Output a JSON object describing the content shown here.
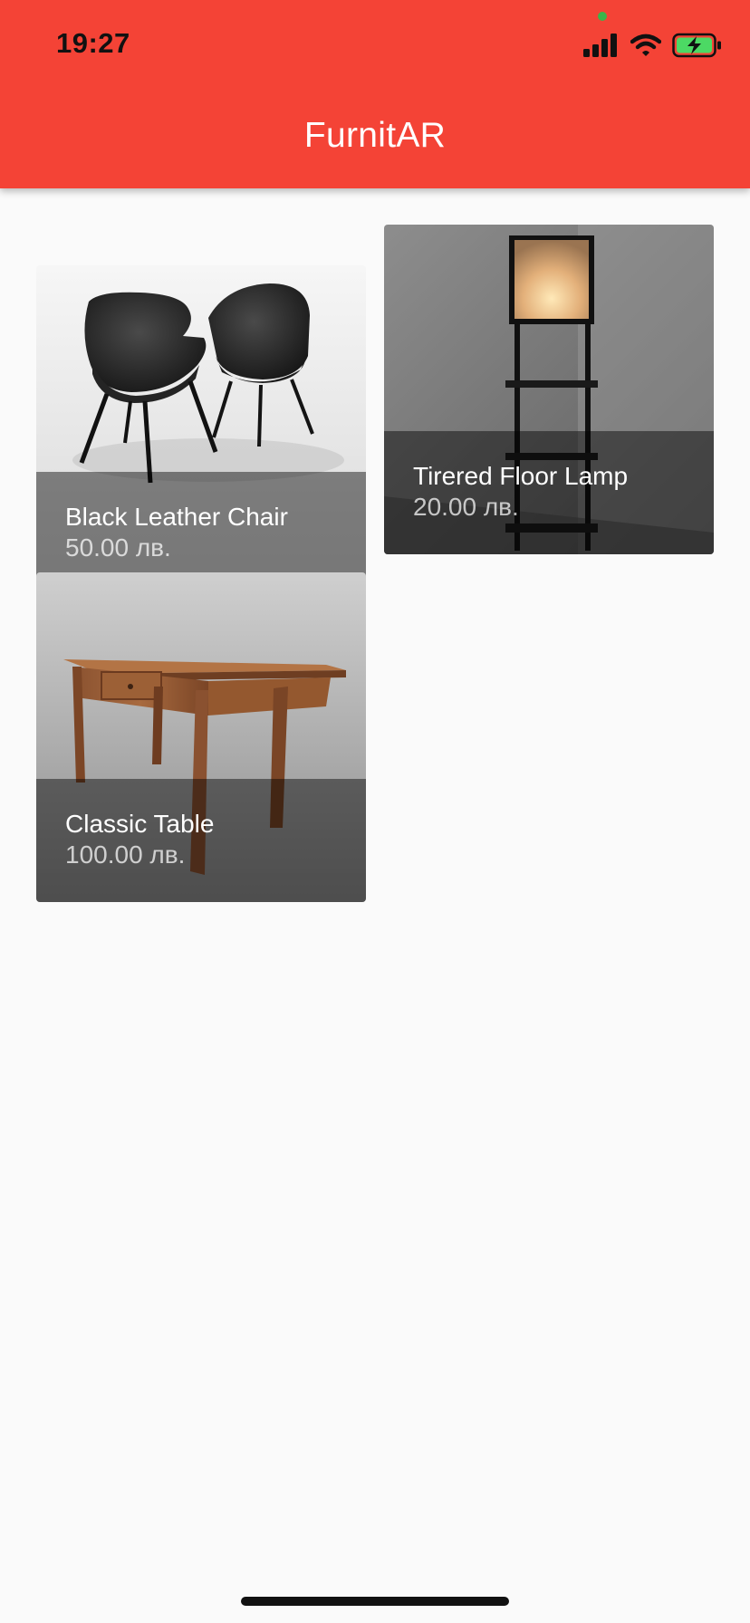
{
  "status_bar": {
    "time": "19:27",
    "icons": [
      "cellular-signal-icon",
      "wifi-icon",
      "battery-charging-icon"
    ],
    "battery_color": "#4CD964",
    "camera_dot_color": "#3BB54A"
  },
  "app_bar": {
    "title": "FurnitAR",
    "color": "#F44336"
  },
  "products": [
    {
      "name": "Black Leather Chair",
      "price": "50.00 лв.",
      "image": "black-leather-chairs-photo"
    },
    {
      "name": "Tirered Floor Lamp",
      "price": "20.00 лв.",
      "image": "tiered-floor-lamp-photo"
    },
    {
      "name": "Classic Table",
      "price": "100.00 лв.",
      "image": "wooden-table-photo"
    }
  ]
}
